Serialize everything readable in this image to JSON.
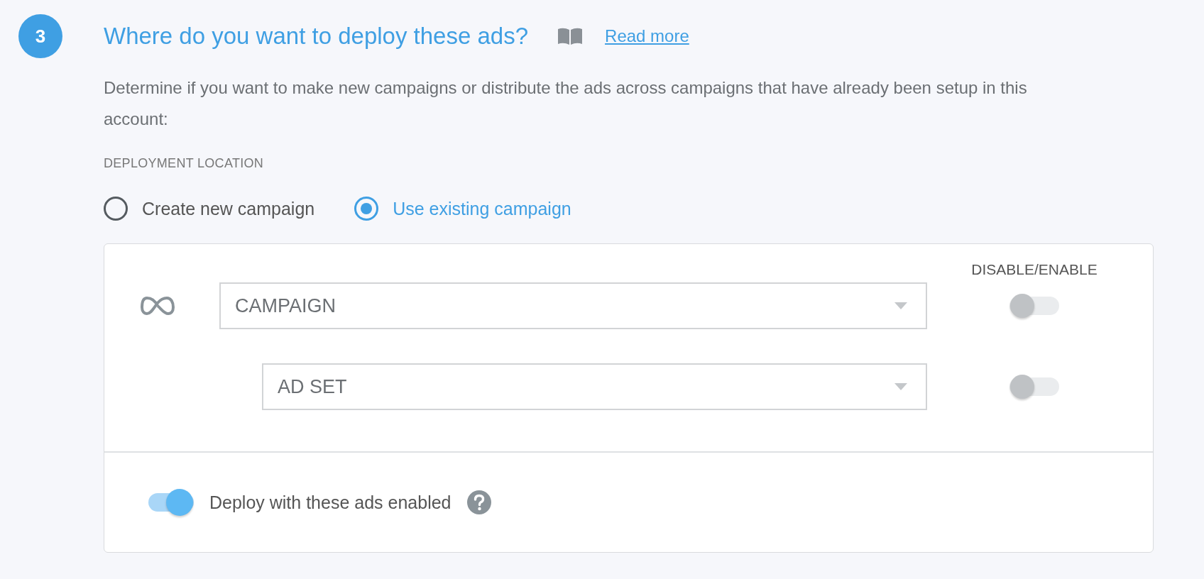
{
  "step": {
    "number": "3",
    "title": "Where do you want to deploy these ads?",
    "read_more": "Read more"
  },
  "description": "Determine if you want to make new campaigns or distribute the ads across campaigns that have already been setup in this account:",
  "deployment_location": {
    "label": "DEPLOYMENT LOCATION",
    "options": [
      {
        "label": "Create new campaign",
        "selected": false
      },
      {
        "label": "Use existing campaign",
        "selected": true
      }
    ]
  },
  "targets": {
    "column_header": "DISABLE/ENABLE",
    "rows": [
      {
        "kind": "campaign",
        "placeholder": "CAMPAIGN",
        "on": false
      },
      {
        "kind": "ad_set",
        "placeholder": "AD SET",
        "on": false
      }
    ]
  },
  "deploy_enabled": {
    "label": "Deploy with these ads enabled",
    "on": true
  }
}
